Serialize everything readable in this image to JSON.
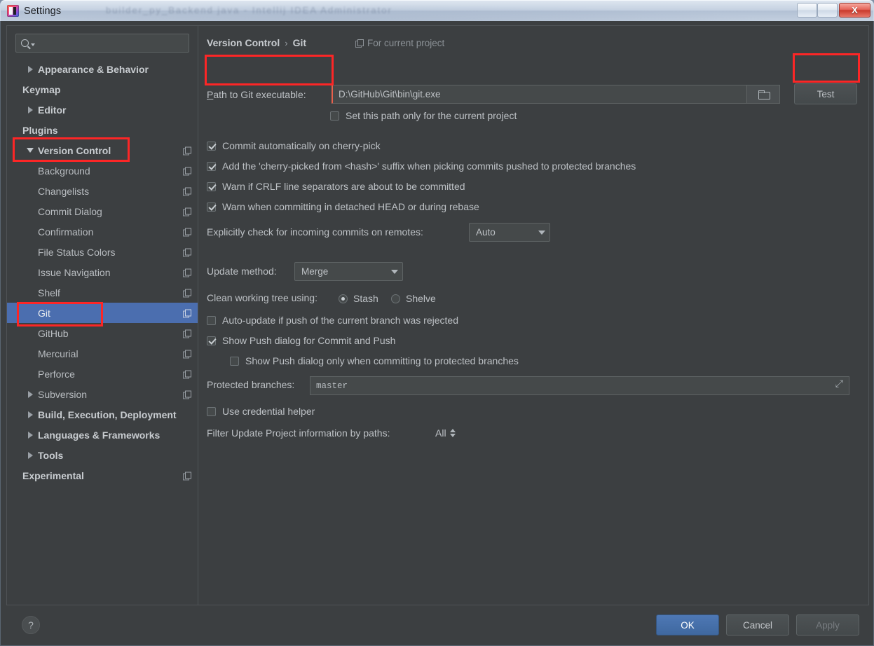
{
  "window": {
    "title": "Settings",
    "ghost_text": "builder_py_Backend java - Intellij IDEA  Administrator",
    "app_icon": "intellij-idea-icon",
    "buttons": {
      "minimize": "",
      "maximize": "",
      "close": "X"
    }
  },
  "sidebar": {
    "search": {
      "placeholder": "",
      "value": "",
      "icon": "search-icon",
      "dropdown_icon": "chevron-down-icon"
    },
    "items": [
      {
        "label": "Appearance & Behavior",
        "level": 0,
        "chevron": "right",
        "bold": true,
        "copy": false,
        "selected": false
      },
      {
        "label": "Keymap",
        "level": 0,
        "chevron": "none",
        "bold": true,
        "copy": false,
        "selected": false
      },
      {
        "label": "Editor",
        "level": 0,
        "chevron": "right",
        "bold": true,
        "copy": false,
        "selected": false
      },
      {
        "label": "Plugins",
        "level": 0,
        "chevron": "none",
        "bold": true,
        "copy": false,
        "selected": false
      },
      {
        "label": "Version Control",
        "level": 0,
        "chevron": "down",
        "bold": true,
        "copy": true,
        "selected": false
      },
      {
        "label": "Background",
        "level": 1,
        "chevron": "none",
        "bold": false,
        "copy": true,
        "selected": false
      },
      {
        "label": "Changelists",
        "level": 1,
        "chevron": "none",
        "bold": false,
        "copy": true,
        "selected": false
      },
      {
        "label": "Commit Dialog",
        "level": 1,
        "chevron": "none",
        "bold": false,
        "copy": true,
        "selected": false
      },
      {
        "label": "Confirmation",
        "level": 1,
        "chevron": "none",
        "bold": false,
        "copy": true,
        "selected": false
      },
      {
        "label": "File Status Colors",
        "level": 1,
        "chevron": "none",
        "bold": false,
        "copy": true,
        "selected": false
      },
      {
        "label": "Issue Navigation",
        "level": 1,
        "chevron": "none",
        "bold": false,
        "copy": true,
        "selected": false
      },
      {
        "label": "Shelf",
        "level": 1,
        "chevron": "none",
        "bold": false,
        "copy": true,
        "selected": false
      },
      {
        "label": "Git",
        "level": 1,
        "chevron": "none",
        "bold": false,
        "copy": true,
        "selected": true
      },
      {
        "label": "GitHub",
        "level": 1,
        "chevron": "none",
        "bold": false,
        "copy": true,
        "selected": false
      },
      {
        "label": "Mercurial",
        "level": 1,
        "chevron": "none",
        "bold": false,
        "copy": true,
        "selected": false
      },
      {
        "label": "Perforce",
        "level": 1,
        "chevron": "none",
        "bold": false,
        "copy": true,
        "selected": false
      },
      {
        "label": "Subversion",
        "level": 1,
        "chevron": "right",
        "bold": false,
        "copy": true,
        "selected": false
      },
      {
        "label": "Build, Execution, Deployment",
        "level": 0,
        "chevron": "right",
        "bold": true,
        "copy": false,
        "selected": false
      },
      {
        "label": "Languages & Frameworks",
        "level": 0,
        "chevron": "right",
        "bold": true,
        "copy": false,
        "selected": false
      },
      {
        "label": "Tools",
        "level": 0,
        "chevron": "right",
        "bold": true,
        "copy": false,
        "selected": false
      },
      {
        "label": "Experimental",
        "level": 0,
        "chevron": "none",
        "bold": true,
        "copy": true,
        "selected": false
      }
    ]
  },
  "main": {
    "breadcrumb": {
      "parent": "Version Control",
      "separator": "›",
      "current": "Git"
    },
    "for_current_project": {
      "label": "For current project",
      "icon": "copy-icon"
    },
    "path": {
      "label": "Path to Git executable:",
      "accesskey": "P",
      "value": "D:\\GitHub\\Git\\bin\\git.exe",
      "browse_icon": "folder-icon",
      "test_button": "Test"
    },
    "set_path_only": {
      "label": "Set this path only for the current project",
      "checked": false
    },
    "checkboxes": [
      {
        "label": "Commit automatically on cherry-pick",
        "checked": true
      },
      {
        "label": "Add the 'cherry-picked from <hash>' suffix when picking commits pushed to protected branches",
        "checked": true
      },
      {
        "label": "Warn if CRLF line separators are about to be committed",
        "checked": true
      },
      {
        "label": "Warn when committing in detached HEAD or during rebase",
        "checked": true
      }
    ],
    "incoming": {
      "label": "Explicitly check for incoming commits on remotes:",
      "value": "Auto"
    },
    "update_method": {
      "label": "Update method:",
      "value": "Merge"
    },
    "clean_tree": {
      "label": "Clean working tree using:",
      "options": [
        {
          "label": "Stash",
          "selected": true
        },
        {
          "label": "Shelve",
          "selected": false
        }
      ]
    },
    "auto_update": {
      "label": "Auto-update if push of the current branch was rejected",
      "checked": false
    },
    "show_push": {
      "label": "Show Push dialog for Commit and Push",
      "checked": true
    },
    "show_push_protected": {
      "label": "Show Push dialog only when committing to protected branches",
      "checked": false
    },
    "protected_branches": {
      "label": "Protected branches:",
      "value": "master",
      "expand_icon": "expand-icon"
    },
    "credential_helper": {
      "label": "Use credential helper",
      "checked": false
    },
    "filter_paths": {
      "label": "Filter Update Project information by paths:",
      "value": "All",
      "spinner_icon": "updown-spinner-icon"
    }
  },
  "footer": {
    "help": "?",
    "ok": "OK",
    "cancel": "Cancel",
    "apply": "Apply"
  },
  "colors": {
    "panel_bg": "#3c3f41",
    "field_bg": "#45494a",
    "selection_blue": "#4b6eaf",
    "accent_red": "#fc2626",
    "primary_button": "#4470ad",
    "text": "#bdc1c5"
  }
}
